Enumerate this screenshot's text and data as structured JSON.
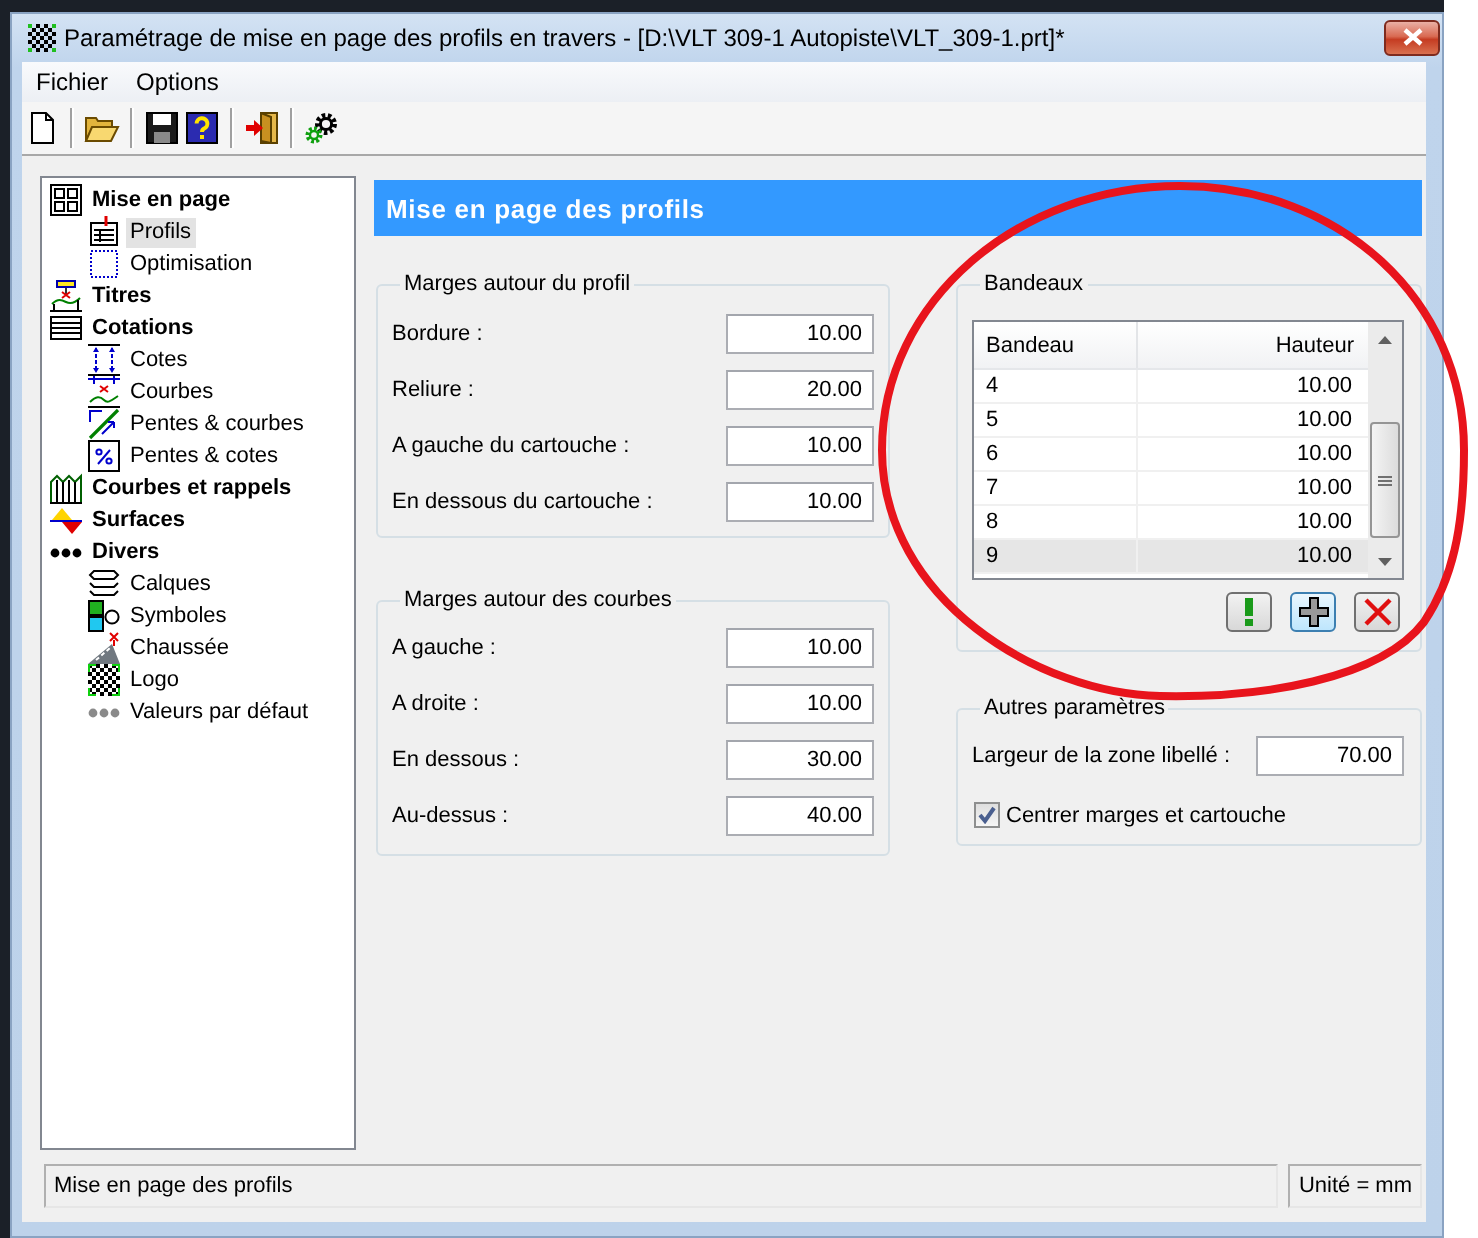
{
  "window": {
    "title": "Paramétrage de mise en page des profils en travers - [D:\\VLT 309-1 Autopiste\\VLT_309-1.prt]*"
  },
  "menu": [
    "Fichier",
    "Options"
  ],
  "tree": [
    {
      "label": "Mise en page",
      "selected": false,
      "children": [
        {
          "label": "Profils",
          "selected": true
        },
        {
          "label": "Optimisation",
          "selected": false
        }
      ]
    },
    {
      "label": "Titres",
      "selected": false
    },
    {
      "label": "Cotations",
      "selected": false,
      "children": [
        {
          "label": "Cotes",
          "selected": false
        },
        {
          "label": "Courbes",
          "selected": false
        },
        {
          "label": "Pentes & courbes",
          "selected": false
        },
        {
          "label": "Pentes & cotes",
          "selected": false
        }
      ]
    },
    {
      "label": "Courbes et rappels",
      "selected": false
    },
    {
      "label": "Surfaces",
      "selected": false
    },
    {
      "label": "Divers",
      "selected": false,
      "children": [
        {
          "label": "Calques",
          "selected": false
        },
        {
          "label": "Symboles",
          "selected": false
        },
        {
          "label": "Chaussée",
          "selected": false
        },
        {
          "label": "Logo",
          "selected": false
        },
        {
          "label": "Valeurs par défaut",
          "selected": false
        }
      ]
    }
  ],
  "panel": {
    "title": "Mise en page des profils"
  },
  "profile_margins": {
    "title": "Marges autour du profil",
    "fields": [
      {
        "label": "Bordure :",
        "value": "10.00"
      },
      {
        "label": "Reliure :",
        "value": "20.00"
      },
      {
        "label": "A gauche du cartouche :",
        "value": "10.00"
      },
      {
        "label": "En dessous du cartouche :",
        "value": "10.00"
      }
    ]
  },
  "curve_margins": {
    "title": "Marges autour des courbes",
    "fields": [
      {
        "label": "A gauche :",
        "value": "10.00"
      },
      {
        "label": "A droite :",
        "value": "10.00"
      },
      {
        "label": "En dessous :",
        "value": "30.00"
      },
      {
        "label": "Au-dessus :",
        "value": "40.00"
      }
    ]
  },
  "bands": {
    "title": "Bandeaux",
    "columns": [
      "Bandeau",
      "Hauteur"
    ],
    "rows": [
      {
        "cells": [
          "4",
          "10.00"
        ],
        "selected": false
      },
      {
        "cells": [
          "5",
          "10.00"
        ],
        "selected": false
      },
      {
        "cells": [
          "6",
          "10.00"
        ],
        "selected": false
      },
      {
        "cells": [
          "7",
          "10.00"
        ],
        "selected": false
      },
      {
        "cells": [
          "8",
          "10.00"
        ],
        "selected": false
      },
      {
        "cells": [
          "9",
          "10.00"
        ],
        "selected": true
      }
    ],
    "buttons": [
      {
        "kind": "check",
        "focused": false
      },
      {
        "kind": "add",
        "focused": true
      },
      {
        "kind": "delete",
        "focused": false
      }
    ]
  },
  "other_settings": {
    "title": "Autres paramètres",
    "fields": [
      {
        "label": "Largeur de la zone libellé :",
        "value": "70.00"
      }
    ],
    "checkbox": {
      "label": "Centrer marges et cartouche",
      "checked": true
    }
  },
  "status_bar": [
    "Mise en page des profils",
    "Unité = mm"
  ]
}
